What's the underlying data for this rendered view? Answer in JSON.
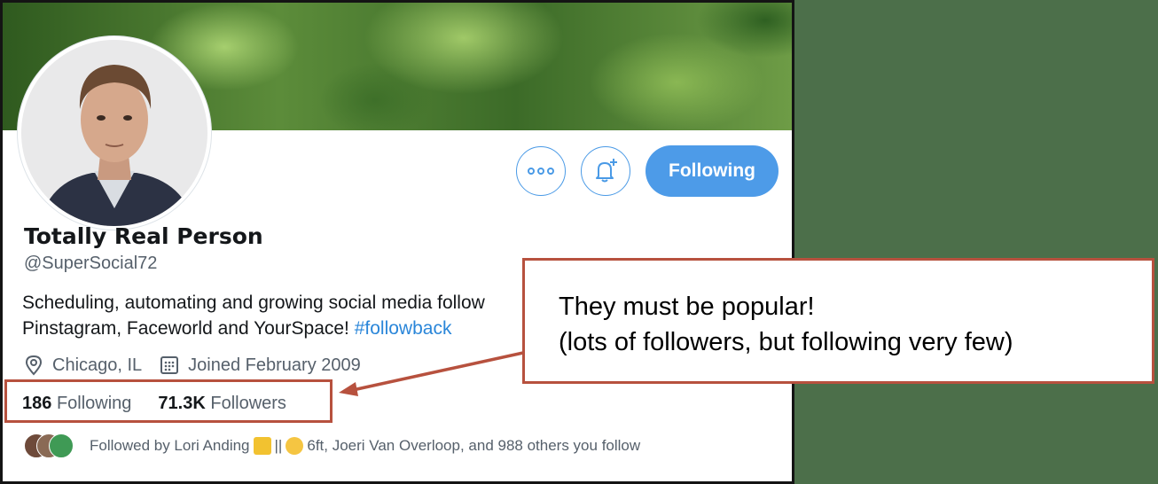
{
  "profile": {
    "name": "Totally Real Person",
    "handle": "@SuperSocial72",
    "bio_line1": "Scheduling, automating and growing social media follow",
    "bio_line2": "Pinstagram, Faceworld and YourSpace! ",
    "hashtag": "#followback",
    "location": "Chicago, IL",
    "joined": "Joined February 2009"
  },
  "actions": {
    "more_icon": "more-dots-icon",
    "notify_icon": "bell-plus-icon",
    "follow_label": "Following"
  },
  "stats": {
    "following_count": "186",
    "following_label": "Following",
    "followers_count": "71.3K",
    "followers_label": "Followers"
  },
  "followed_by": {
    "prefix": "Followed by Lori Anding ",
    "separator": " || ",
    "rest": " 6ft, Joeri Van Overloop, and 988 others you follow"
  },
  "callout": {
    "line1": "They must be popular!",
    "line2": "(lots of followers, but following very few)"
  },
  "colors": {
    "accent": "#4d9be8",
    "annotation": "#b7513e",
    "background": "#4c6f4a"
  }
}
